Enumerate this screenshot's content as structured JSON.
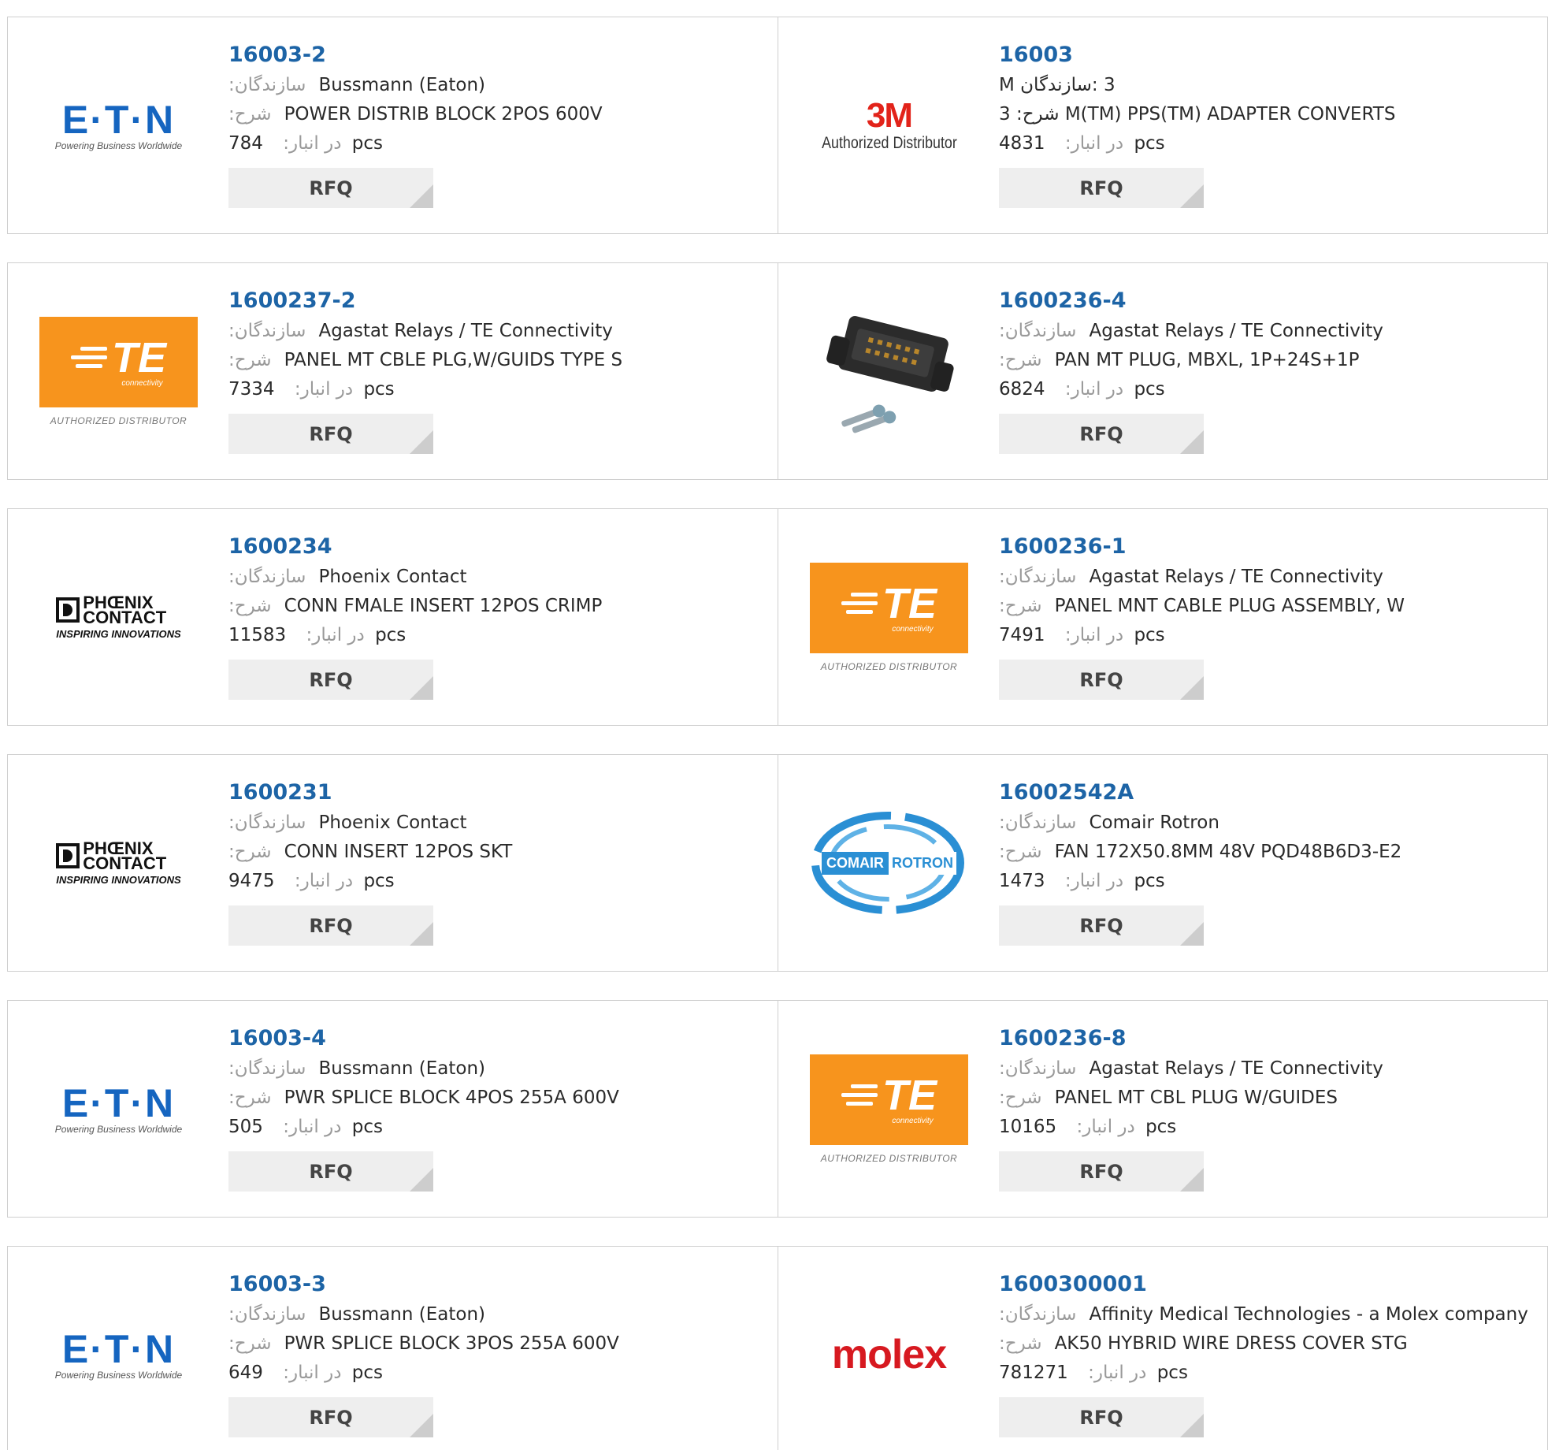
{
  "labels": {
    "manufacturer": ":سازندگان",
    "description": ":شرح",
    "stock": "در انبار:",
    "unit": "pcs",
    "rfq": "RFQ"
  },
  "logos": {
    "eaton": {
      "name": "E·T·N",
      "tagline": "Powering Business Worldwide"
    },
    "three_m": {
      "name": "3M",
      "tagline": "Authorized Distributor"
    },
    "te": {
      "name": "TE",
      "sub": "connectivity",
      "tagline": "AUTHORIZED DISTRIBUTOR"
    },
    "phoenix": {
      "name1": "PHŒNIX",
      "name2": "CONTACT",
      "tagline": "INSPIRING INNOVATIONS"
    },
    "comair": {
      "left": "COMAIR",
      "right": "ROTRON"
    },
    "molex": {
      "name": "molex"
    }
  },
  "colors": {
    "link": "#1d64a6",
    "te_orange": "#f7941d",
    "eaton_blue": "#1565c0",
    "three_m_red": "#e2231a",
    "molex_red": "#d71920",
    "comair_blue": "#2a8fd4"
  },
  "products": [
    {
      "pn": "16003-2",
      "logo": "eaton",
      "manufacturer": "Bussmann (Eaton)",
      "description": "POWER DISTRIB BLOCK 2POS 600V",
      "stock": "784"
    },
    {
      "pn": "16003",
      "logo": "three_m",
      "manufacturer": "3 :سازندگان M",
      "description": "3 :شرح M(TM) PPS(TM) ADAPTER CONVERTS",
      "stock": "4831",
      "special": true
    },
    {
      "pn": "1600237-2",
      "logo": "te",
      "manufacturer": "Agastat Relays / TE Connectivity",
      "description": "PANEL MT CBLE PLG,W/GUIDS TYPE S",
      "stock": "7334"
    },
    {
      "pn": "1600236-4",
      "logo": "connector",
      "manufacturer": "Agastat Relays / TE Connectivity",
      "description": "PAN MT PLUG, MBXL, 1P+24S+1P",
      "stock": "6824"
    },
    {
      "pn": "1600234",
      "logo": "phoenix",
      "manufacturer": "Phoenix Contact",
      "description": "CONN FMALE INSERT 12POS CRIMP",
      "stock": "11583"
    },
    {
      "pn": "1600236-1",
      "logo": "te",
      "manufacturer": "Agastat Relays / TE Connectivity",
      "description": "PANEL MNT CABLE PLUG ASSEMBLY, W",
      "stock": "7491"
    },
    {
      "pn": "1600231",
      "logo": "phoenix",
      "manufacturer": "Phoenix Contact",
      "description": "CONN INSERT 12POS SKT",
      "stock": "9475"
    },
    {
      "pn": "16002542A",
      "logo": "comair",
      "manufacturer": "Comair Rotron",
      "description": "FAN 172X50.8MM 48V PQD48B6D3-E2",
      "stock": "1473"
    },
    {
      "pn": "16003-4",
      "logo": "eaton",
      "manufacturer": "Bussmann (Eaton)",
      "description": "PWR SPLICE BLOCK 4POS 255A 600V",
      "stock": "505"
    },
    {
      "pn": "1600236-8",
      "logo": "te",
      "manufacturer": "Agastat Relays / TE Connectivity",
      "description": "PANEL MT CBL PLUG W/GUIDES",
      "stock": "10165"
    },
    {
      "pn": "16003-3",
      "logo": "eaton",
      "manufacturer": "Bussmann (Eaton)",
      "description": "PWR SPLICE BLOCK 3POS 255A 600V",
      "stock": "649"
    },
    {
      "pn": "1600300001",
      "logo": "molex",
      "manufacturer": "Affinity Medical Technologies - a Molex company",
      "description": "AK50 HYBRID WIRE DRESS COVER STG",
      "stock": "781271"
    }
  ]
}
